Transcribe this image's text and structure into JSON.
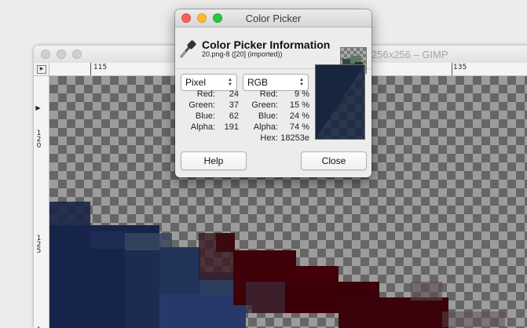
{
  "gimp_window": {
    "title": "256x256 – GIMP",
    "ruler_h": [
      "115",
      "135"
    ],
    "ruler_v": [
      "120",
      "125",
      "1"
    ]
  },
  "color_picker": {
    "title": "Color Picker",
    "heading": "Color Picker Information",
    "subtitle": "20.png-8 ([20] (imported))",
    "mode_left": "Pixel",
    "mode_right": "RGB",
    "pixel_values": [
      {
        "label": "Red:",
        "value": "24"
      },
      {
        "label": "Green:",
        "value": "37"
      },
      {
        "label": "Blue:",
        "value": "62"
      },
      {
        "label": "Alpha:",
        "value": "191"
      }
    ],
    "rgb_values": [
      {
        "label": "Red:",
        "value": "9 %"
      },
      {
        "label": "Green:",
        "value": "15 %"
      },
      {
        "label": "Blue:",
        "value": "24 %"
      },
      {
        "label": "Alpha:",
        "value": "74 %"
      },
      {
        "label": "Hex:",
        "value": "18253e"
      }
    ],
    "help_label": "Help",
    "close_label": "Close",
    "swatch_color": "#18253e"
  }
}
